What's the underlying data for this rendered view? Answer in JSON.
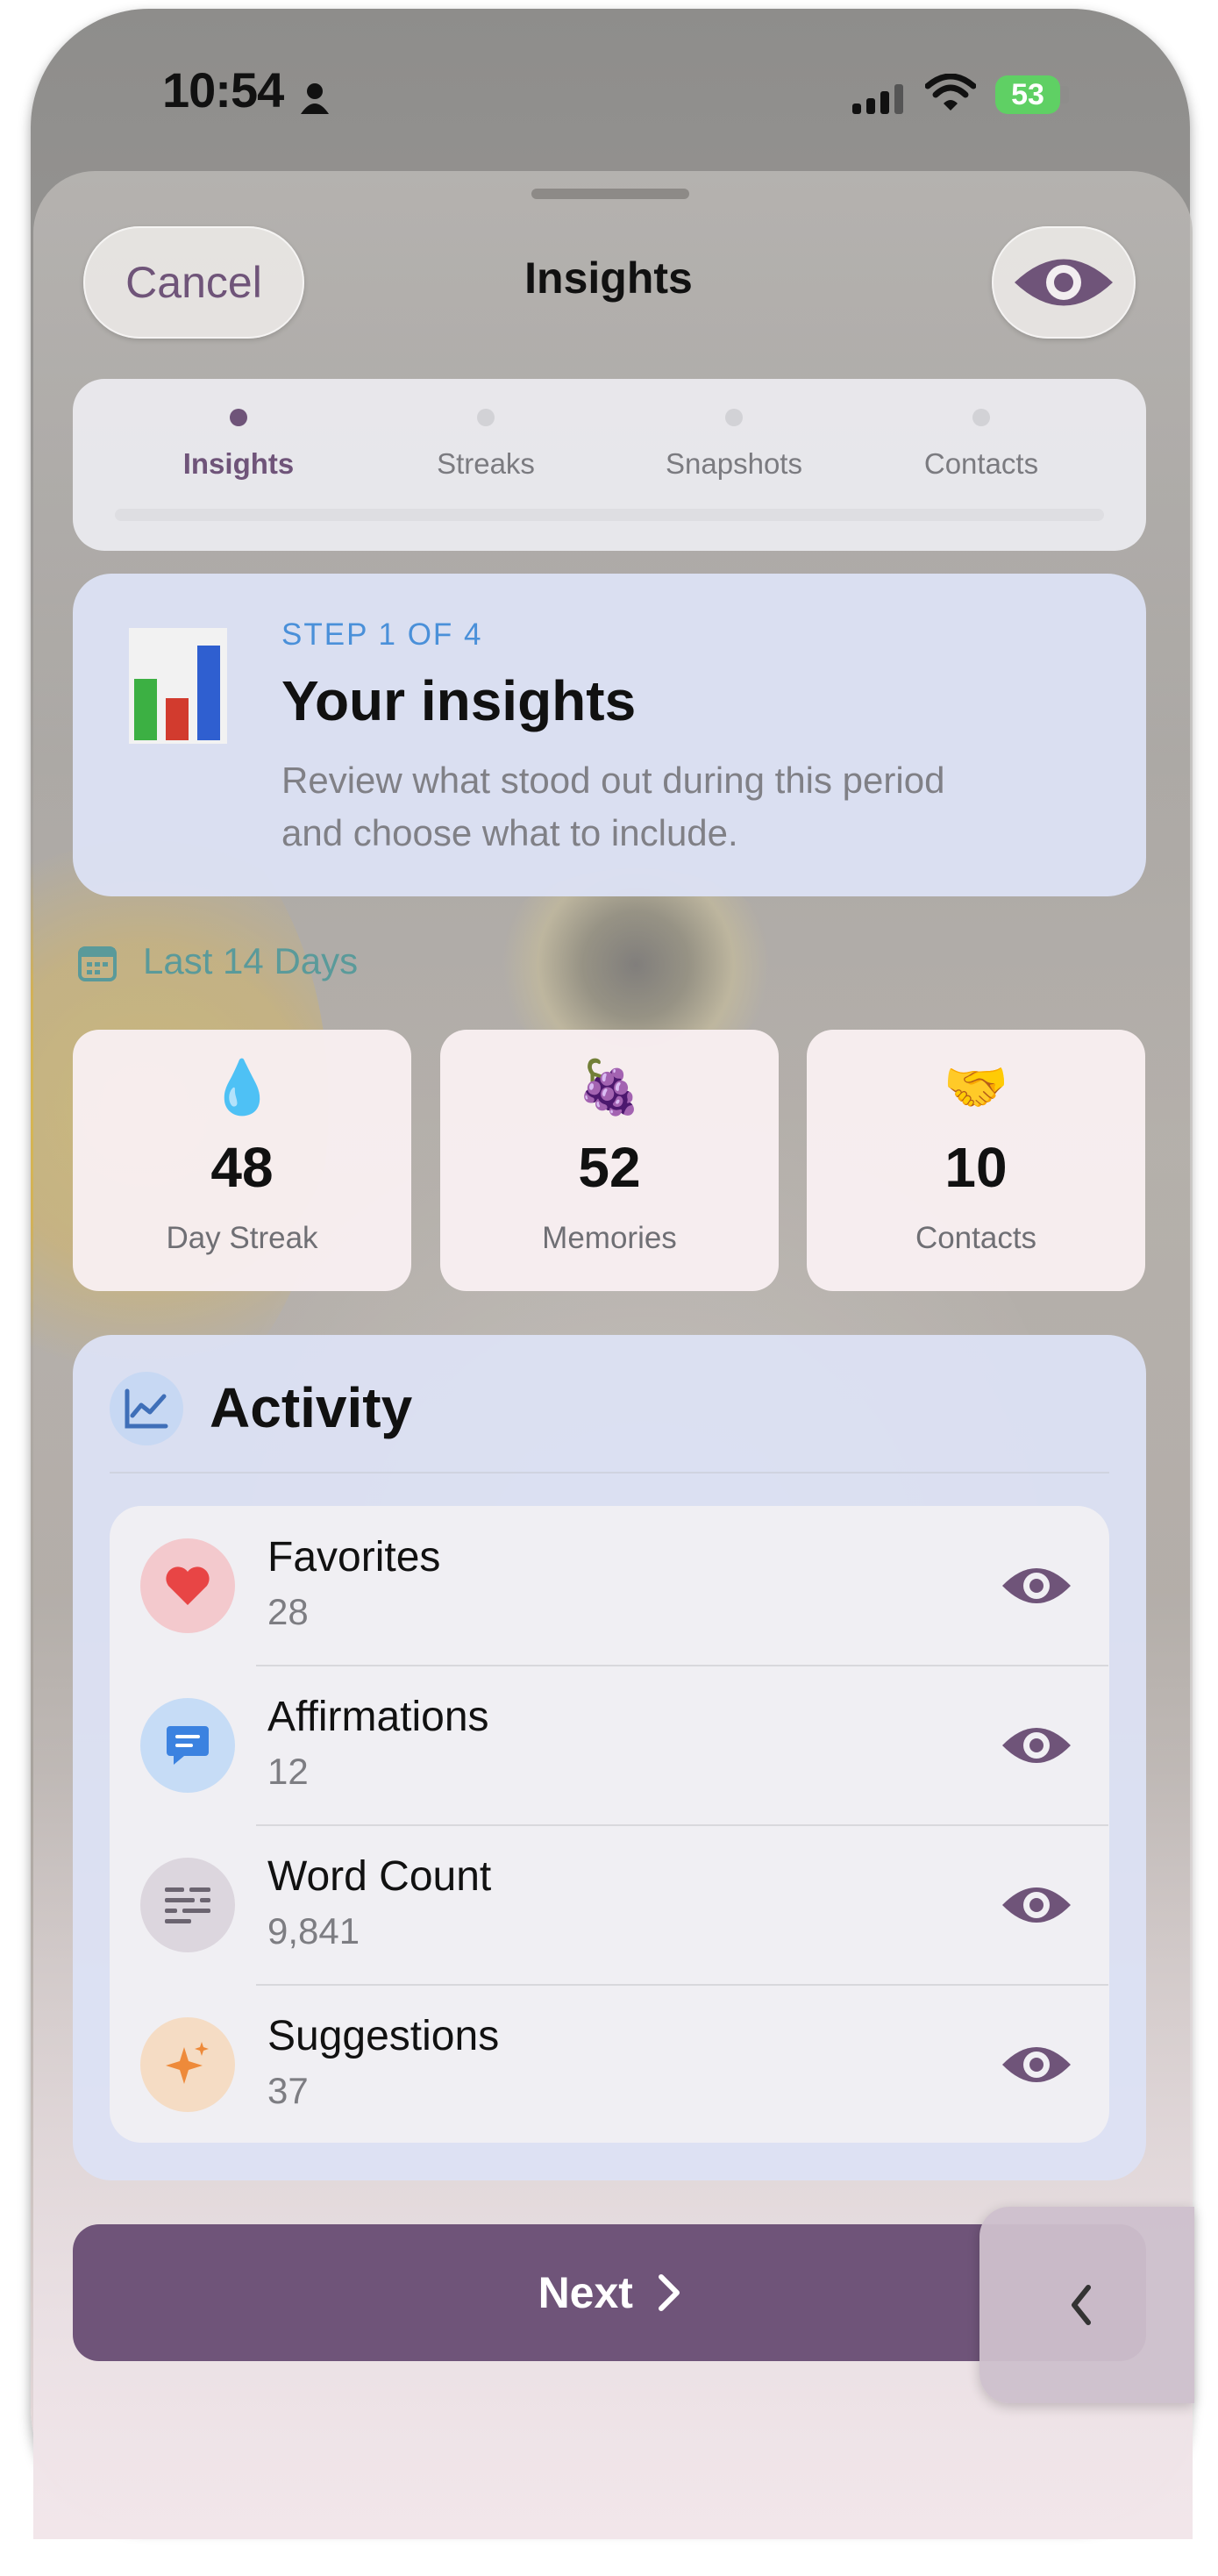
{
  "status": {
    "time": "10:54",
    "battery": "53"
  },
  "nav": {
    "cancel_label": "Cancel",
    "title": "Insights"
  },
  "steps": [
    {
      "label": "Insights",
      "active": true
    },
    {
      "label": "Streaks",
      "active": false
    },
    {
      "label": "Snapshots",
      "active": false
    },
    {
      "label": "Contacts",
      "active": false
    }
  ],
  "intro": {
    "step": "STEP 1 OF 4",
    "heading": "Your insights",
    "description_line1": "Review what stood out during this period",
    "description_line2": "and choose what to include."
  },
  "period": {
    "label": "Last 14 Days"
  },
  "stats": [
    {
      "icon": "💧",
      "value": "48",
      "label": "Day Streak"
    },
    {
      "icon": "🍇",
      "value": "52",
      "label": "Memories"
    },
    {
      "icon": "🤝",
      "value": "10",
      "label": "Contacts"
    }
  ],
  "activity": {
    "title": "Activity",
    "rows": [
      {
        "title": "Favorites",
        "value": "28",
        "icon": "heart-icon"
      },
      {
        "title": "Affirmations",
        "value": "12",
        "icon": "message-bubble-icon"
      },
      {
        "title": "Word Count",
        "value": "9,841",
        "icon": "text-lines-icon"
      },
      {
        "title": "Suggestions",
        "value": "37",
        "icon": "sparkles-icon"
      }
    ]
  },
  "footer": {
    "next_label": "Next"
  },
  "colors": {
    "accent": "#6f5479",
    "step_blue": "#4a90d9",
    "period_teal": "#5a9a9a"
  }
}
